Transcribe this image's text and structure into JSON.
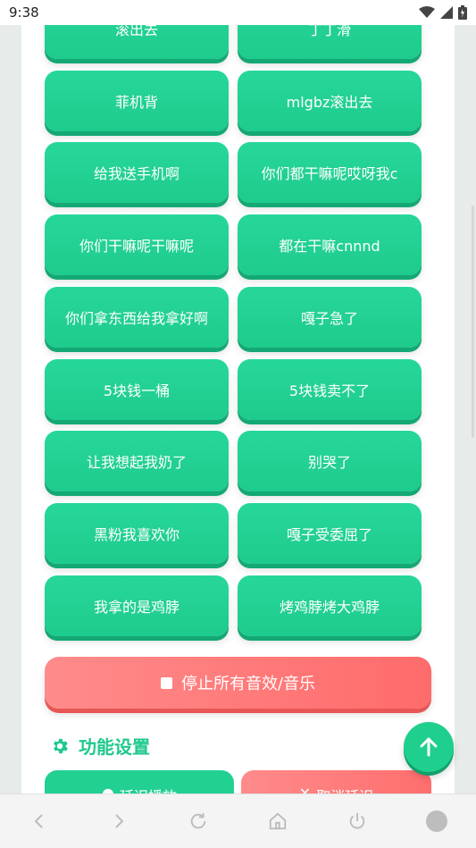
{
  "status_bar": {
    "time": "9:38"
  },
  "sound_buttons": [
    [
      "滚出去",
      "丁丁滑"
    ],
    [
      "菲机背",
      "mlgbz滚出去"
    ],
    [
      "给我送手机啊",
      "你们都干嘛呢哎呀我c"
    ],
    [
      "你们干嘛呢干嘛呢",
      "都在干嘛cnnnd"
    ],
    [
      "你们拿东西给我拿好啊",
      "嘎子急了"
    ],
    [
      "5块钱一桶",
      "5块钱卖不了"
    ],
    [
      "让我想起我奶了",
      "别哭了"
    ],
    [
      "黑粉我喜欢你",
      "嘎子受委屈了"
    ],
    [
      "我拿的是鸡脖",
      "烤鸡脖烤大鸡脖"
    ]
  ],
  "stop_button": {
    "label": "停止所有音效/音乐"
  },
  "settings": {
    "title": "功能设置",
    "delay_play_label": "延迟播放",
    "cancel_delay_label": "取消延迟"
  },
  "colors": {
    "green": "#22d092",
    "red": "#ff6b6b"
  },
  "icons": {
    "gear": "gear-icon",
    "stop": "stop-square-icon",
    "scroll_top": "arrow-up-icon",
    "nav": [
      "back-icon",
      "forward-icon",
      "refresh-icon",
      "home-icon",
      "power-icon",
      "circle-icon"
    ]
  }
}
